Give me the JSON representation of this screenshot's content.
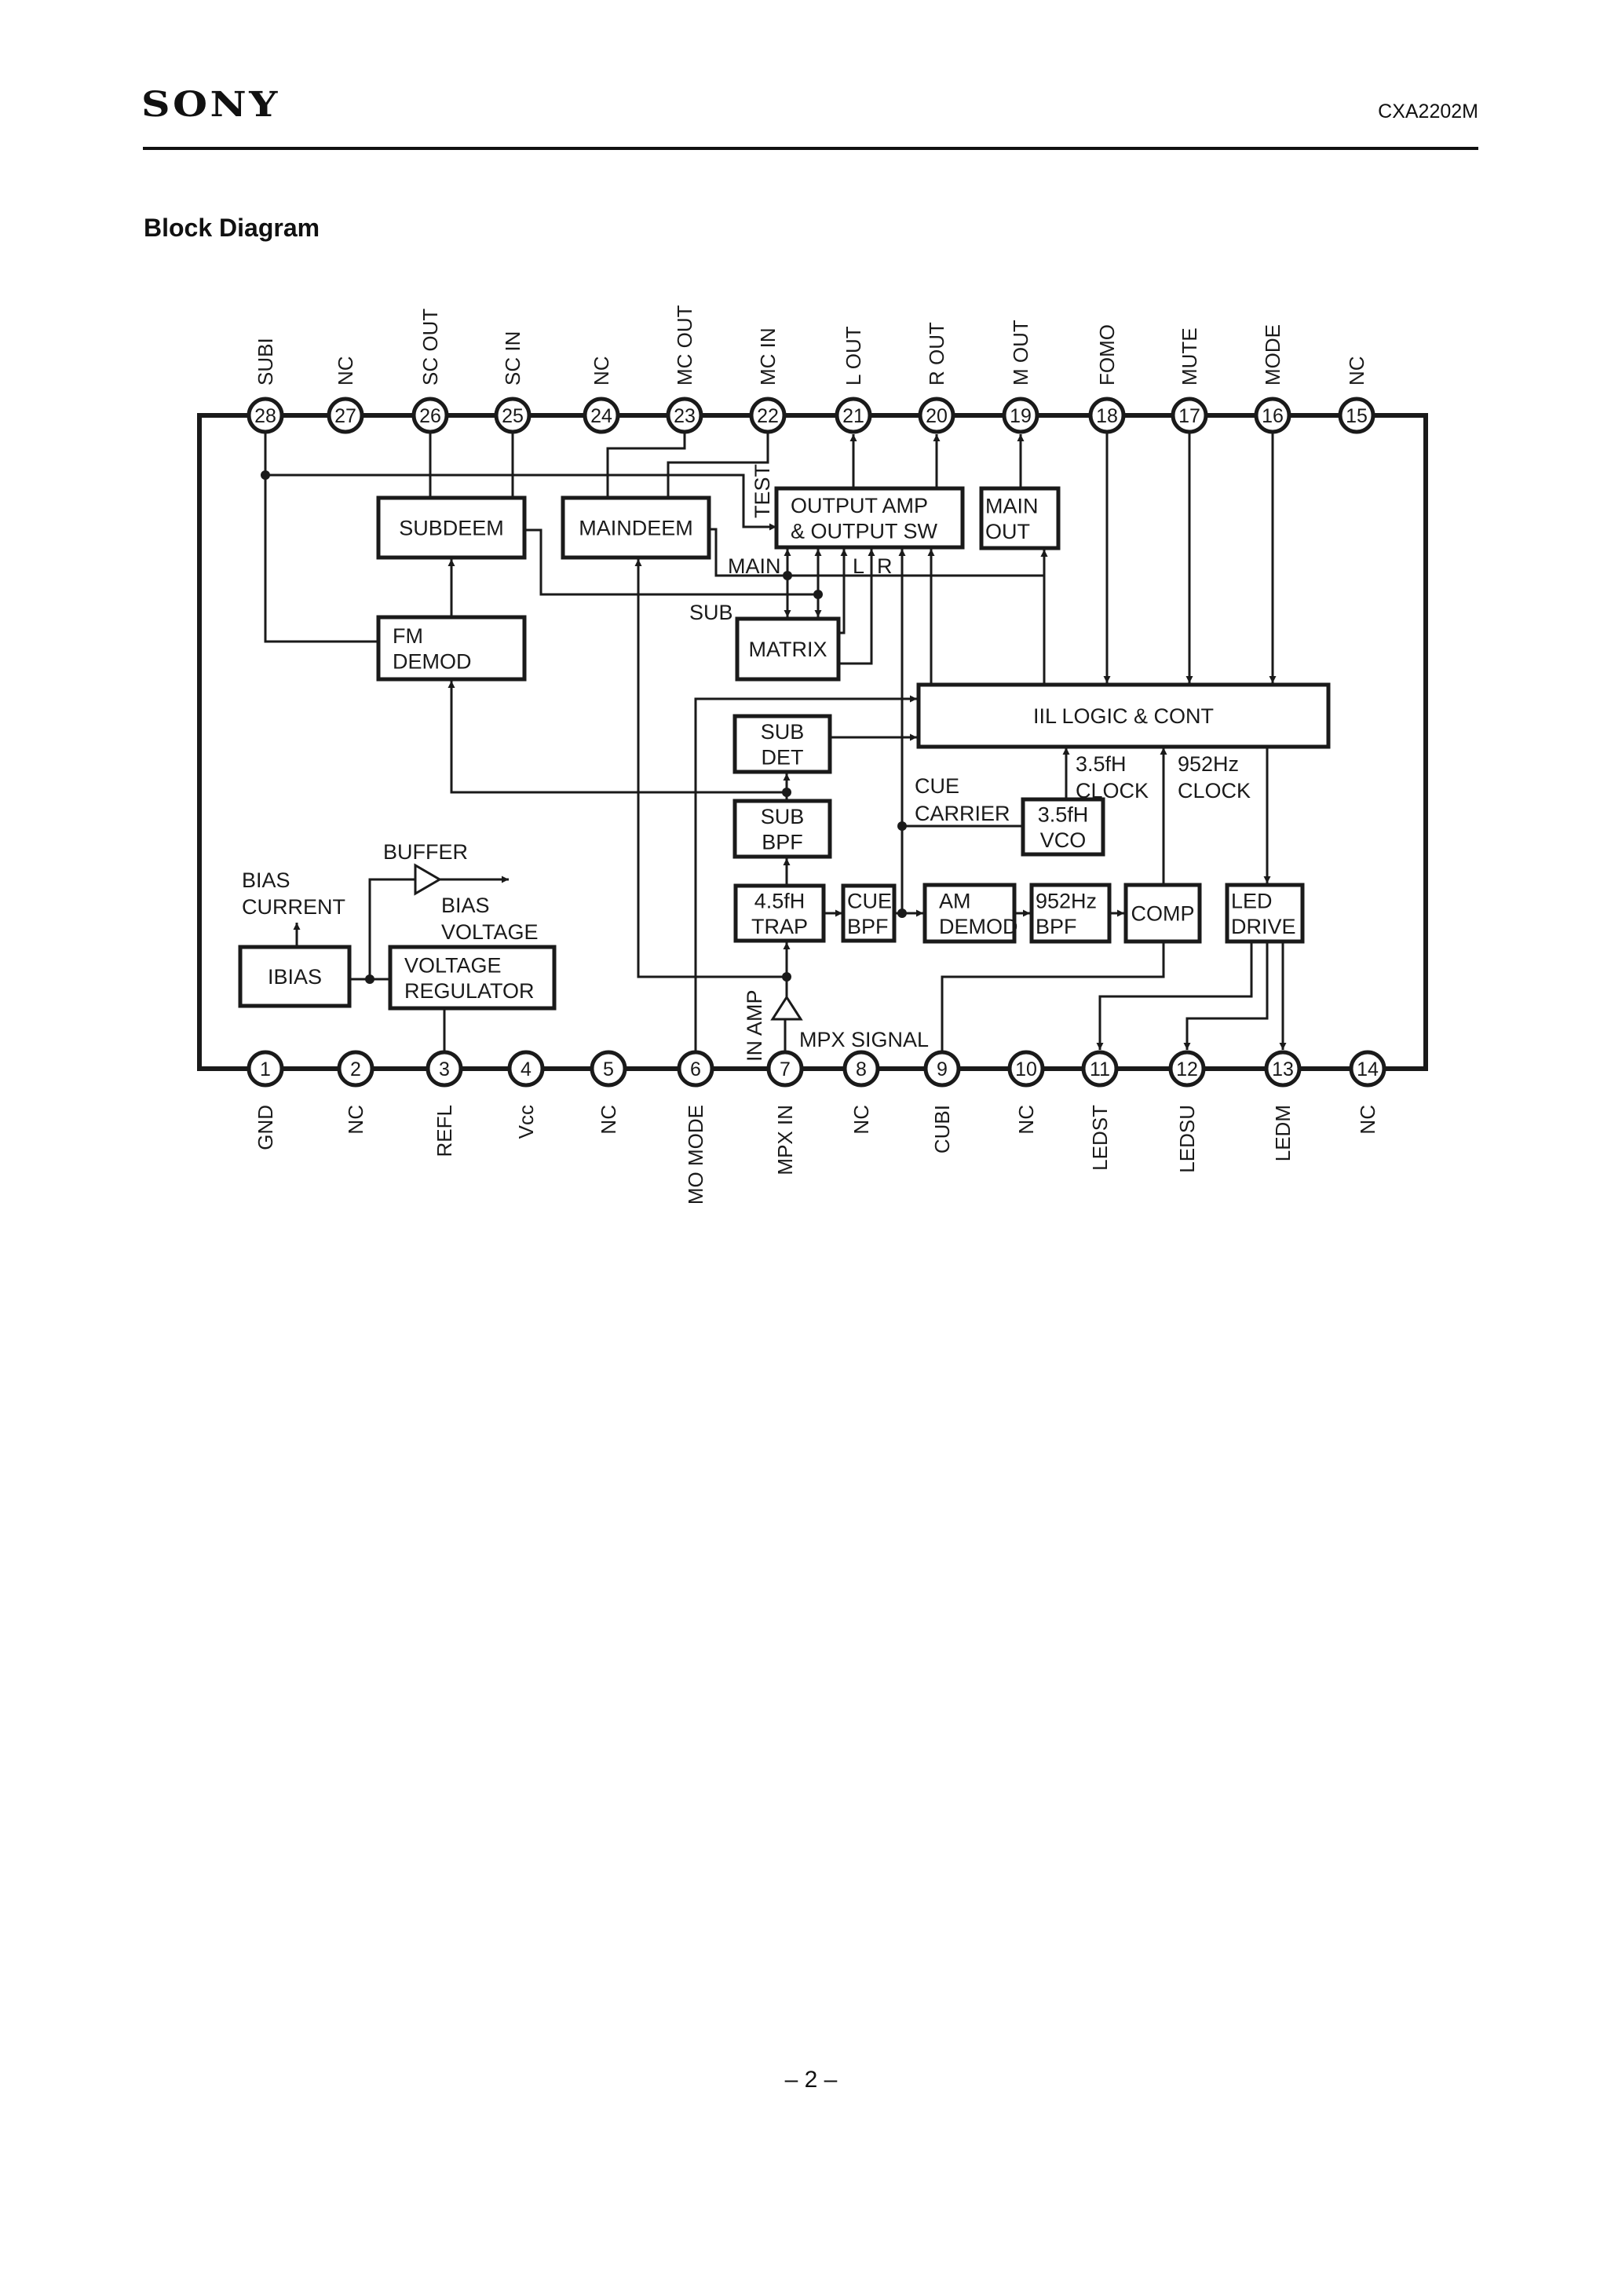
{
  "header": {
    "brand": "SONY",
    "model": "CXA2202M"
  },
  "section_title": "Block Diagram",
  "footer": {
    "page_number": "– 2 –"
  },
  "colors": {
    "ink": "#1a1a1a",
    "background": "#ffffff"
  },
  "pins_top": [
    {
      "number": "28",
      "label": "SUBI"
    },
    {
      "number": "27",
      "label": "NC"
    },
    {
      "number": "26",
      "label": "SC OUT"
    },
    {
      "number": "25",
      "label": "SC IN"
    },
    {
      "number": "24",
      "label": "NC"
    },
    {
      "number": "23",
      "label": "MC OUT"
    },
    {
      "number": "22",
      "label": "MC IN"
    },
    {
      "number": "21",
      "label": "L OUT"
    },
    {
      "number": "20",
      "label": "R OUT"
    },
    {
      "number": "19",
      "label": "M OUT"
    },
    {
      "number": "18",
      "label": "FOMO"
    },
    {
      "number": "17",
      "label": "MUTE"
    },
    {
      "number": "16",
      "label": "MODE"
    },
    {
      "number": "15",
      "label": "NC"
    }
  ],
  "pins_bottom": [
    {
      "number": "1",
      "label": "GND"
    },
    {
      "number": "2",
      "label": "NC"
    },
    {
      "number": "3",
      "label": "REFL"
    },
    {
      "number": "4",
      "label": "Vcc"
    },
    {
      "number": "5",
      "label": "NC"
    },
    {
      "number": "6",
      "label": "MO MODE"
    },
    {
      "number": "7",
      "label": "MPX IN"
    },
    {
      "number": "8",
      "label": "NC"
    },
    {
      "number": "9",
      "label": "CUBI"
    },
    {
      "number": "10",
      "label": "NC"
    },
    {
      "number": "11",
      "label": "LEDST"
    },
    {
      "number": "12",
      "label": "LEDSU"
    },
    {
      "number": "13",
      "label": "LEDM"
    },
    {
      "number": "14",
      "label": "NC"
    }
  ],
  "blocks": {
    "subdeem": {
      "lines": [
        "SUBDEEM"
      ]
    },
    "maindeem": {
      "lines": [
        "MAINDEEM"
      ]
    },
    "fm_demod": {
      "lines": [
        "FM",
        "DEMOD"
      ]
    },
    "output_amp": {
      "lines": [
        "OUTPUT AMP",
        "& OUTPUT SW"
      ]
    },
    "main_out": {
      "lines": [
        "MAIN",
        "OUT"
      ]
    },
    "matrix": {
      "lines": [
        "MATRIX"
      ]
    },
    "iil_logic": {
      "lines": [
        "IIL LOGIC & CONT"
      ]
    },
    "sub_det": {
      "lines": [
        "SUB",
        "DET"
      ]
    },
    "sub_bpf": {
      "lines": [
        "SUB",
        "BPF"
      ]
    },
    "vco": {
      "lines": [
        "3.5fH",
        "VCO"
      ]
    },
    "trap": {
      "lines": [
        "4.5fH",
        "TRAP"
      ]
    },
    "cue_bpf": {
      "lines": [
        "CUE",
        "BPF"
      ]
    },
    "am_demod": {
      "lines": [
        "AM",
        "DEMOD"
      ]
    },
    "bpf_952": {
      "lines": [
        "952Hz",
        "BPF"
      ]
    },
    "comp": {
      "lines": [
        "COMP"
      ]
    },
    "led_drive": {
      "lines": [
        "LED",
        "DRIVE"
      ]
    },
    "ibias": {
      "lines": [
        "IBIAS"
      ]
    },
    "voltage_regulator": {
      "lines": [
        "VOLTAGE",
        "REGULATOR"
      ]
    }
  },
  "annotations": {
    "test": "TEST",
    "main": "MAIN",
    "sub": "SUB",
    "l": "L",
    "r": "R",
    "cue_carrier_1": "CUE",
    "cue_carrier_2": "CARRIER",
    "clock_35_1": "3.5fH",
    "clock_35_2": "CLOCK",
    "clock_952_1": "952Hz",
    "clock_952_2": "CLOCK",
    "buffer": "BUFFER",
    "bias_current_1": "BIAS",
    "bias_current_2": "CURRENT",
    "bias_voltage_1": "BIAS",
    "bias_voltage_2": "VOLTAGE",
    "in_amp": "IN AMP",
    "mpx_signal": "MPX SIGNAL"
  }
}
